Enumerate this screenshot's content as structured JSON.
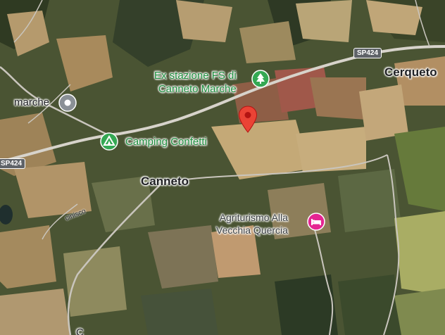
{
  "map": {
    "labels": {
      "cerqueto": "Cerqueto",
      "canneto": "Canneto",
      "marche": "marche",
      "ex_stazione_line1": "Ex stazione FS di",
      "ex_stazione_line2": "Canneto Marche",
      "camping": "Camping Confetti",
      "agriturismo_line1": "Agriturismo Alla",
      "agriturismo_line2": "Vecchia Quercia",
      "cinisco": "cinisco",
      "c_label": "C"
    },
    "road_shields": {
      "sp424_top": "SP424",
      "sp424_left": "SP424"
    },
    "icons": {
      "tree": "tree-icon",
      "camping": "camping-tent-icon",
      "place": "place-dot-icon",
      "hotel": "hotel-bed-icon",
      "pin": "red-location-pin"
    },
    "colors": {
      "poi_green": "#34a853",
      "hotel_pink": "#e52592",
      "pin_red": "#ea4335",
      "place_gray": "#8a9096"
    }
  }
}
